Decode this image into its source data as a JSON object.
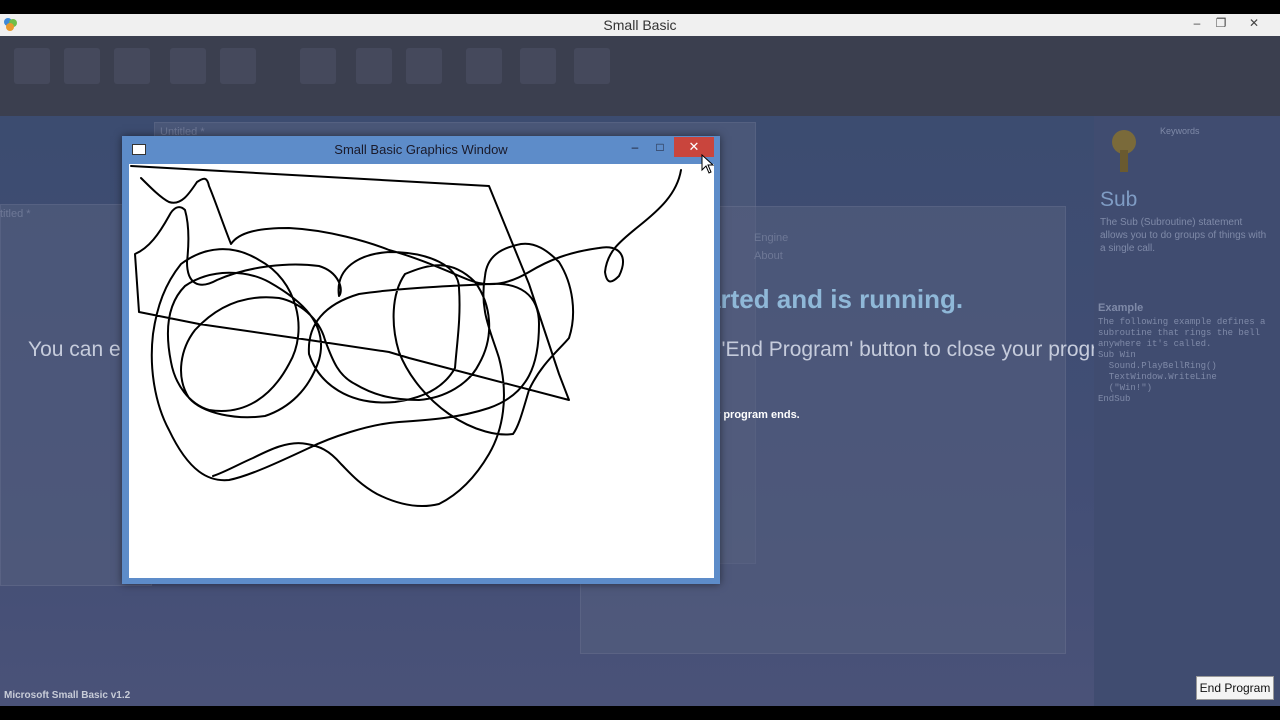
{
  "app": {
    "title": "Small Basic",
    "status_text": "Microsoft Small Basic v1.2",
    "end_program_label": "End Program"
  },
  "background": {
    "tab_title": "Untitled *",
    "side_tab": "titled *",
    "partial_heading": "arted and is running.",
    "partial_message_left": "You can e",
    "partial_message_right": "e 'End Program' button to close your program and get",
    "partial_hint": "r program ends.",
    "faint_lines": [
      "Engine",
      "About"
    ]
  },
  "help_panel": {
    "category": "Keywords",
    "title": "Sub",
    "description": "The Sub (Subroutine) statement allows you to do groups of things with a single call.",
    "example_heading": "Example",
    "example_text": "The following example defines a subroutine that rings the bell anywhere it's called.",
    "example_code": "Sub Win\n  Sound.PlayBellRing()\n  TextWindow.WriteLine\n  (\"Win!\")\nEndSub"
  },
  "graphics_window": {
    "title": "Small Basic Graphics Window",
    "background": "#ffffff",
    "stroke_color": "#000000",
    "controls": [
      "minimize-icon",
      "maximize-icon",
      "close-icon"
    ]
  }
}
